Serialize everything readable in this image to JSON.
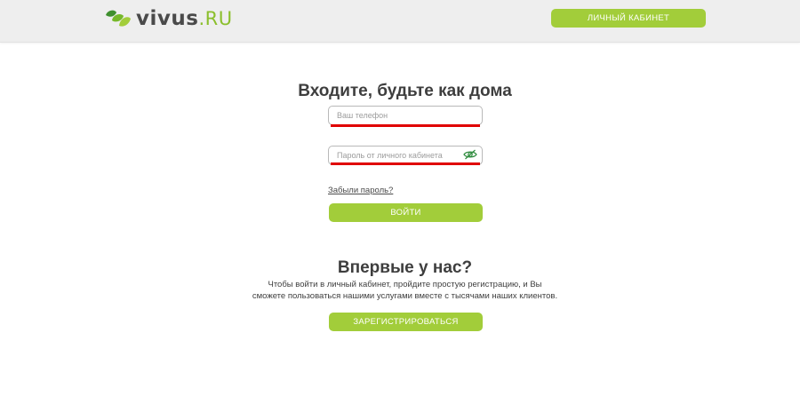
{
  "header": {
    "logo_main": "vivus",
    "logo_suffix": ".RU",
    "cabinet_button": "ЛИЧНЫЙ КАБИНЕТ"
  },
  "login": {
    "title": "Входите, будьте как дома",
    "phone_placeholder": "Ваш телефон",
    "password_placeholder": "Пароль от личного кабинета",
    "forgot_link": "Забыли пароль?",
    "submit_button": "ВОЙТИ"
  },
  "register": {
    "title": "Впервые у нас?",
    "description_line1": "Чтобы войти в личный кабинет, пройдите простую регистрацию, и Вы",
    "description_line2": "сможете пользоваться нашими услугами вместе с тысячами наших клиентов.",
    "button": "ЗАРЕГИСТРИРОВАТЬСЯ"
  },
  "icons": {
    "logo": "vivus-leaf-logo-icon",
    "password_toggle": "eye-crossed-icon"
  },
  "colors": {
    "accent_green": "#a2cd3a",
    "logo_green": "#8bbf2c",
    "error_underline": "#e00000",
    "header_bg": "#eeeeee"
  }
}
